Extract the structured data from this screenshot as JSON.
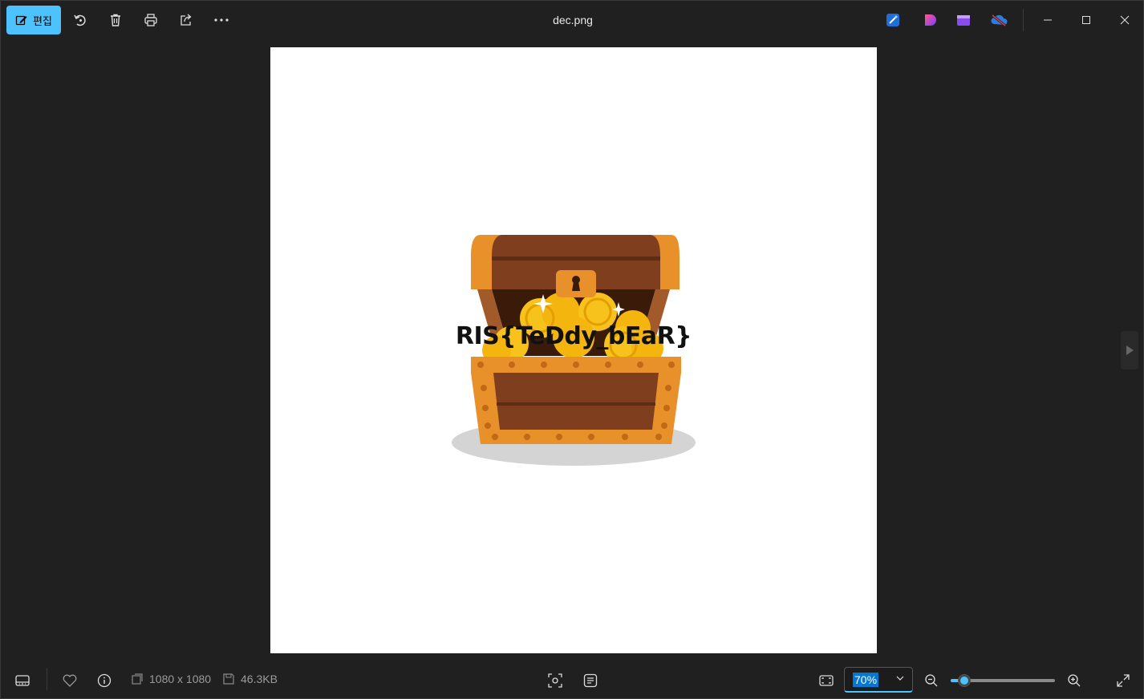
{
  "titlebar": {
    "edit_label": "편집",
    "filename": "dec.png",
    "icons": [
      "edit-icon",
      "rotate-icon",
      "delete-icon",
      "print-icon",
      "share-icon",
      "more-icon"
    ],
    "app_icons": [
      "designer-icon",
      "clipchamp-icon",
      "video-editor-icon",
      "onedrive-icon"
    ],
    "window_controls": [
      "minimize-icon",
      "maximize-icon",
      "close-icon"
    ]
  },
  "image": {
    "flag_text": "RIS{TeDdy_bEaR}"
  },
  "bottombar": {
    "dimensions": "1080 x 1080",
    "file_size": "46.3KB",
    "zoom": "70%",
    "zoom_fraction": 0.1
  },
  "colors": {
    "accent": "#4cc2ff",
    "background": "#202020",
    "chest_wood": "#7f3f1e",
    "chest_trim": "#e8912a",
    "gold": "#f7c21b"
  }
}
